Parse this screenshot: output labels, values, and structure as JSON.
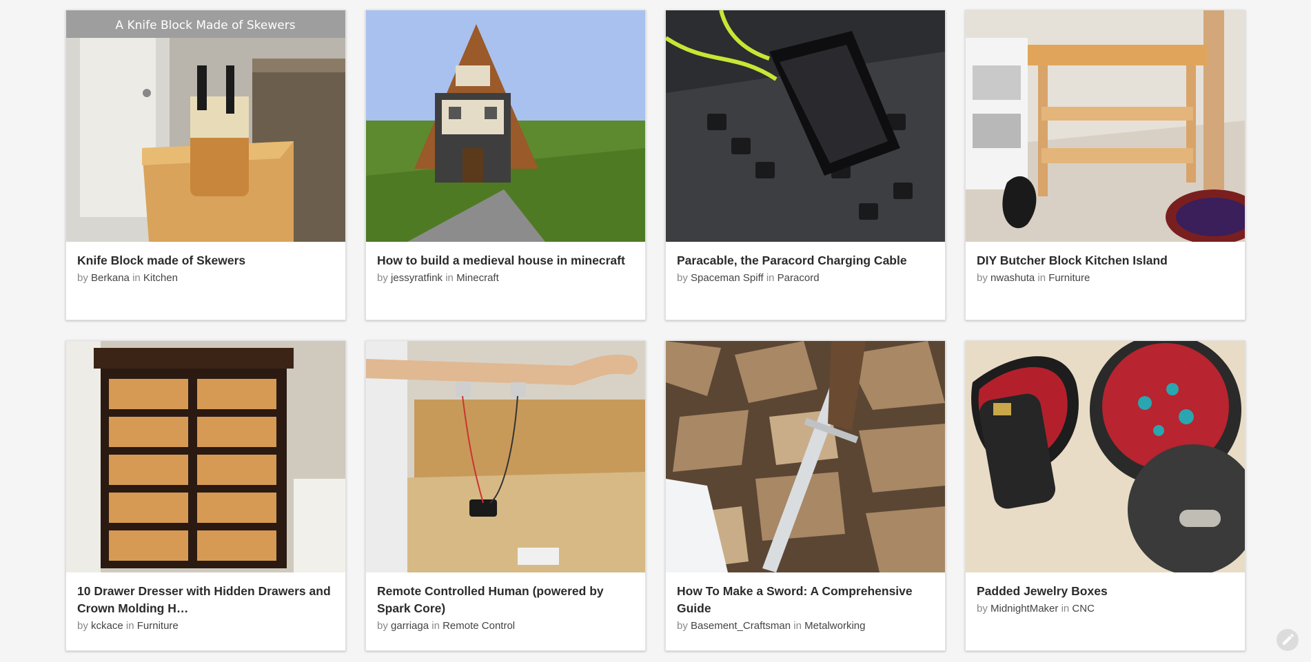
{
  "cards": [
    {
      "title": "Knife Block made of Skewers",
      "by": "by",
      "author": "Berkana",
      "in": "in",
      "category": "Kitchen",
      "image_caption": "A Knife Block Made of Skewers"
    },
    {
      "title": "How to build a medieval house in minecraft",
      "by": "by",
      "author": "jessyratfink",
      "in": "in",
      "category": "Minecraft"
    },
    {
      "title": "Paracable, the Paracord Charging Cable",
      "by": "by",
      "author": "Spaceman Spiff",
      "in": "in",
      "category": "Paracord"
    },
    {
      "title": "DIY Butcher Block Kitchen Island",
      "by": "by",
      "author": "nwashuta",
      "in": "in",
      "category": "Furniture"
    },
    {
      "title": "10 Drawer Dresser with Hidden Drawers and Crown Molding H…",
      "by": "by",
      "author": "kckace",
      "in": "in",
      "category": "Furniture"
    },
    {
      "title": "Remote Controlled Human (powered by Spark Core)",
      "by": "by",
      "author": "garriaga",
      "in": "in",
      "category": "Remote Control"
    },
    {
      "title": "How To Make a Sword: A Comprehensive Guide",
      "by": "by",
      "author": "Basement_Craftsman",
      "in": "in",
      "category": "Metalworking"
    },
    {
      "title": "Padded Jewelry Boxes",
      "by": "by",
      "author": "MidnightMaker",
      "in": "in",
      "category": "CNC"
    }
  ],
  "feedback_button": {
    "icon": "pencil-icon"
  },
  "colors": {
    "background": "#f5f5f5",
    "card": "#ffffff",
    "title": "#2b2b2b",
    "meta": "#888888"
  }
}
